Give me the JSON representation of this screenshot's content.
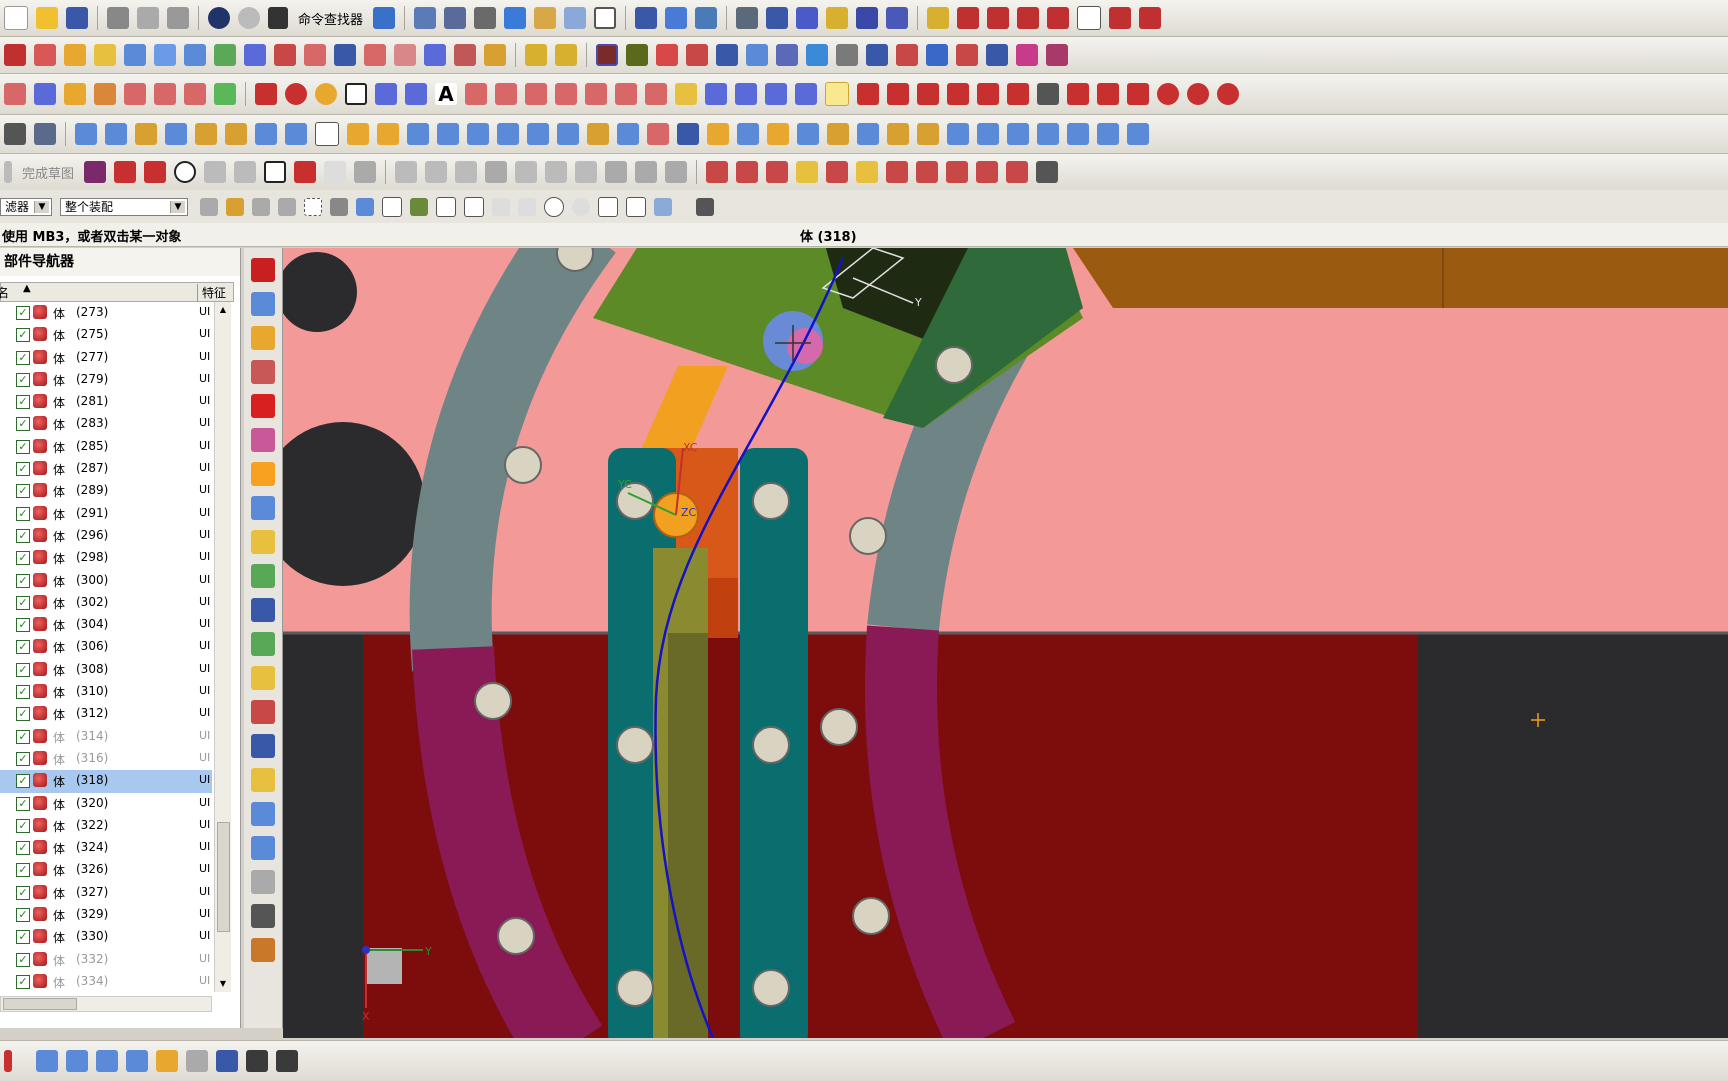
{
  "toolbar": {
    "command_finder_label": "命令查找器"
  },
  "sketch_toolbar": {
    "finish_sketch_label": "完成草图"
  },
  "selection_bar": {
    "filter_label": "滤器",
    "scope_value": "整个装配"
  },
  "status": {
    "prompt": "使用 MB3，或者双击某一对象",
    "selected": "体 (318)"
  },
  "navigator": {
    "title": "部件导航器",
    "col_name": "名",
    "col_feature": "特征",
    "items": [
      {
        "label": "体",
        "num": "(273)",
        "feat": "UI"
      },
      {
        "label": "体",
        "num": "(275)",
        "feat": "UI"
      },
      {
        "label": "体",
        "num": "(277)",
        "feat": "UI"
      },
      {
        "label": "体",
        "num": "(279)",
        "feat": "UI"
      },
      {
        "label": "体",
        "num": "(281)",
        "feat": "UI"
      },
      {
        "label": "体",
        "num": "(283)",
        "feat": "UI"
      },
      {
        "label": "体",
        "num": "(285)",
        "feat": "UI"
      },
      {
        "label": "体",
        "num": "(287)",
        "feat": "UI"
      },
      {
        "label": "体",
        "num": "(289)",
        "feat": "UI"
      },
      {
        "label": "体",
        "num": "(291)",
        "feat": "UI"
      },
      {
        "label": "体",
        "num": "(296)",
        "feat": "UI"
      },
      {
        "label": "体",
        "num": "(298)",
        "feat": "UI"
      },
      {
        "label": "体",
        "num": "(300)",
        "feat": "UI"
      },
      {
        "label": "体",
        "num": "(302)",
        "feat": "UI"
      },
      {
        "label": "体",
        "num": "(304)",
        "feat": "UI"
      },
      {
        "label": "体",
        "num": "(306)",
        "feat": "UI"
      },
      {
        "label": "体",
        "num": "(308)",
        "feat": "UI"
      },
      {
        "label": "体",
        "num": "(310)",
        "feat": "UI"
      },
      {
        "label": "体",
        "num": "(312)",
        "feat": "UI"
      },
      {
        "label": "体",
        "num": "(314)",
        "feat": "UI"
      },
      {
        "label": "体",
        "num": "(316)",
        "feat": "UI"
      },
      {
        "label": "体",
        "num": "(318)",
        "feat": "UI"
      },
      {
        "label": "体",
        "num": "(320)",
        "feat": "UI"
      },
      {
        "label": "体",
        "num": "(322)",
        "feat": "UI"
      },
      {
        "label": "体",
        "num": "(324)",
        "feat": "UI"
      },
      {
        "label": "体",
        "num": "(326)",
        "feat": "UI"
      },
      {
        "label": "体",
        "num": "(327)",
        "feat": "UI"
      },
      {
        "label": "体",
        "num": "(329)",
        "feat": "UI"
      },
      {
        "label": "体",
        "num": "(330)",
        "feat": "UI"
      },
      {
        "label": "体",
        "num": "(332)",
        "feat": "UI"
      },
      {
        "label": "体",
        "num": "(334)",
        "feat": "UI"
      }
    ]
  },
  "viewport": {
    "axis_labels": {
      "xc": "XC",
      "yc": "YC",
      "zc": "ZC",
      "y": "Y",
      "x": "X"
    }
  },
  "colors": {
    "background_pink": "#f39a98",
    "dark_gray": "#2b2b2e",
    "dark_red": "#7d0d0d",
    "teal": "#0b6e6e",
    "magenta": "#8a1a55",
    "green": "#5b8a26",
    "orange": "#f2a020",
    "steel": "#6f8585",
    "curve_blue": "#1212c8"
  }
}
